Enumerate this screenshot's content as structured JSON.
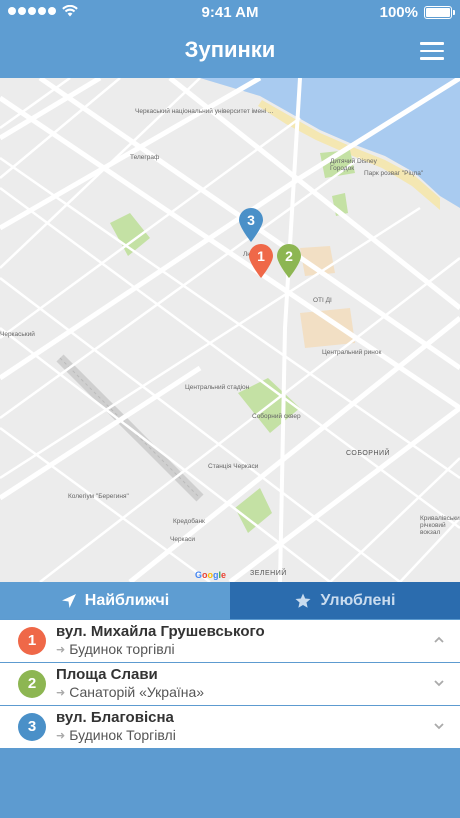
{
  "status_bar": {
    "time": "9:41 AM",
    "battery": "100%",
    "icons": [
      "signal-dots-icon",
      "wifi-icon",
      "battery-icon"
    ]
  },
  "nav": {
    "title": "Зупинки",
    "menu_icon": "hamburger-icon"
  },
  "map": {
    "labels": {
      "university": "Черкаський національний університет імені ...",
      "telegraph": "Телеграф",
      "lyubava": "Любава",
      "oti": "ОТІ ДІ",
      "central_market": "Центральний ринок",
      "stadium": "Центральний стадіон",
      "sobornyi_square": "Соборний сквер",
      "sobornyi": "СОБОРНИЙ",
      "zelenyi": "ЗЕЛЕНИЙ",
      "kredobank": "Кредобанк",
      "station": "Станція Черкаси",
      "cherkasy": "Черкаси",
      "kolegium": "Колегіум \"Берегиня\"",
      "park": "Парк розваг \"Ріцпа\"",
      "disney": "Дитячий Disney Городок",
      "river_station": "Кривалівський річковий вокзал",
      "left_cut": "Черкаський"
    },
    "google": "Google",
    "pins": [
      {
        "num": "1",
        "color": "#ef6848"
      },
      {
        "num": "2",
        "color": "#8db652"
      },
      {
        "num": "3",
        "color": "#4a90c8"
      }
    ]
  },
  "tabs": [
    {
      "label": "Найближчі",
      "icon": "location-arrow-icon",
      "active": true
    },
    {
      "label": "Улюблені",
      "icon": "star-icon",
      "active": false
    }
  ],
  "stops": [
    {
      "num": "1",
      "title": "вул. Михайла Грушевського",
      "subtitle": "Будинок торгівлі",
      "color": "#ef6848",
      "chevron": "chevron-up-icon"
    },
    {
      "num": "2",
      "title": "Площа Слави",
      "subtitle": "Санаторій «Україна»",
      "color": "#8db652",
      "chevron": "chevron-down-icon"
    },
    {
      "num": "3",
      "title": "вул. Благовісна",
      "subtitle": "Будинок Торгівлі",
      "color": "#4a90c8",
      "chevron": "chevron-down-icon"
    }
  ]
}
